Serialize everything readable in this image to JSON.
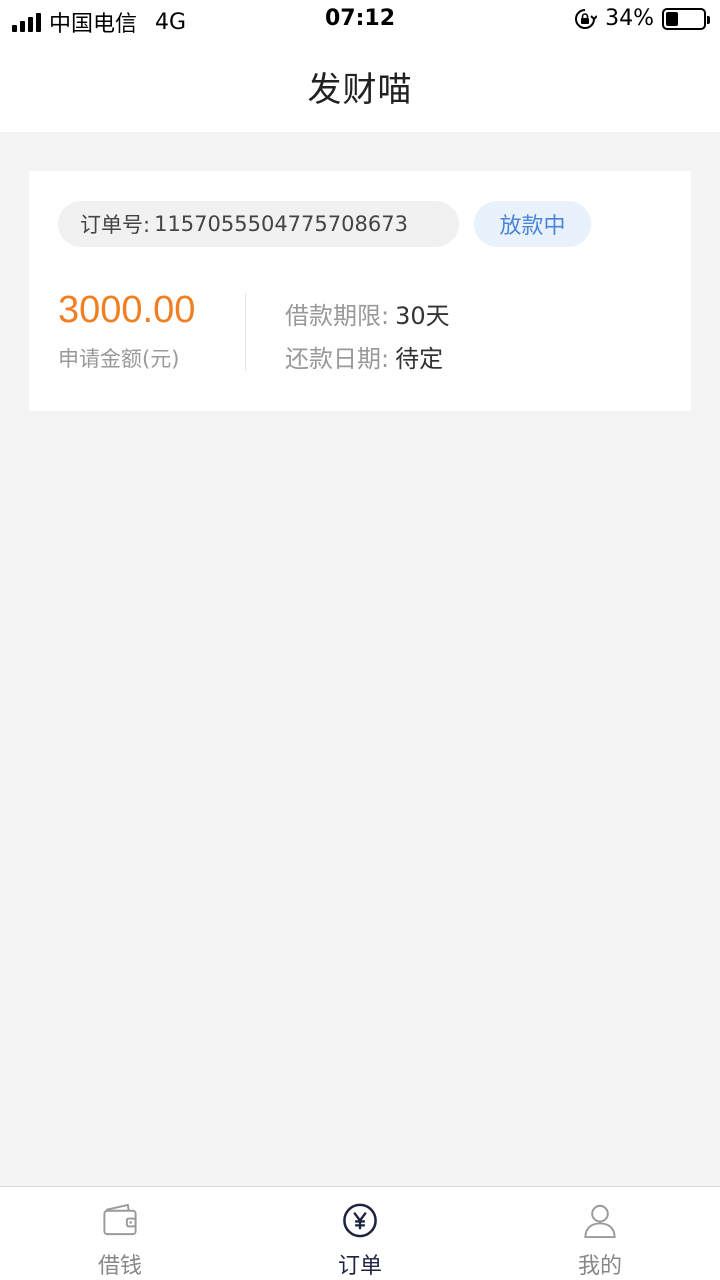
{
  "status_bar": {
    "carrier": "中国电信",
    "network": "4G",
    "time": "07:12",
    "battery_percent_text": "34%",
    "battery_level": 0.34
  },
  "header": {
    "title": "发财喵"
  },
  "order": {
    "order_no_label": "订单号:",
    "order_no": "1157055504775708673",
    "status": "放款中",
    "amount": "3000.00",
    "amount_label": "申请金额(元)",
    "term_label": "借款期限:",
    "term_value": "30天",
    "repay_date_label": "还款日期:",
    "repay_date_value": "待定"
  },
  "tabs": [
    {
      "label": "借钱",
      "icon": "wallet-icon",
      "active": false
    },
    {
      "label": "订单",
      "icon": "yuan-circle-icon",
      "active": true
    },
    {
      "label": "我的",
      "icon": "user-icon",
      "active": false
    }
  ],
  "colors": {
    "accent_orange": "#f07f22",
    "status_blue": "#4a86d6",
    "active_tab": "#1e2340"
  }
}
